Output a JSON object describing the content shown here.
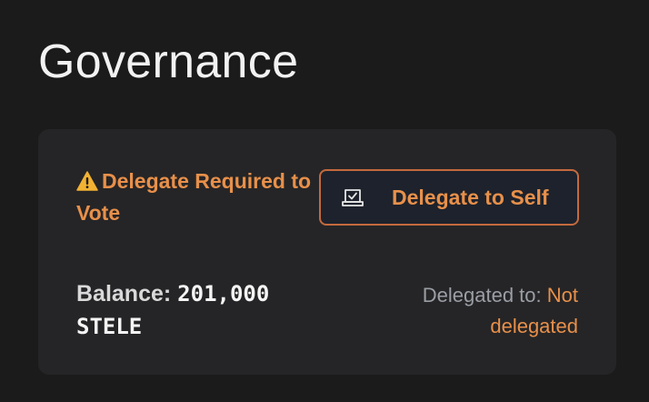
{
  "page": {
    "title": "Governance"
  },
  "governance_card": {
    "warning": {
      "icon": "warning-triangle-icon",
      "text": "Delegate Required to Vote"
    },
    "delegate_button": {
      "icon": "vote-box-icon",
      "label": "Delegate to Self"
    },
    "balance": {
      "label": "Balance:",
      "amount": "201,000",
      "token": "STELE"
    },
    "delegation": {
      "label": "Delegated to:",
      "value": "Not delegated"
    }
  },
  "colors": {
    "background": "#1b1b1c",
    "card": "#252527",
    "accent_orange": "#e8904a",
    "button_border": "#c46a3d",
    "button_fill": "#1d222c",
    "muted_text": "#9a9ea5",
    "warning_icon": "#f2b233"
  }
}
